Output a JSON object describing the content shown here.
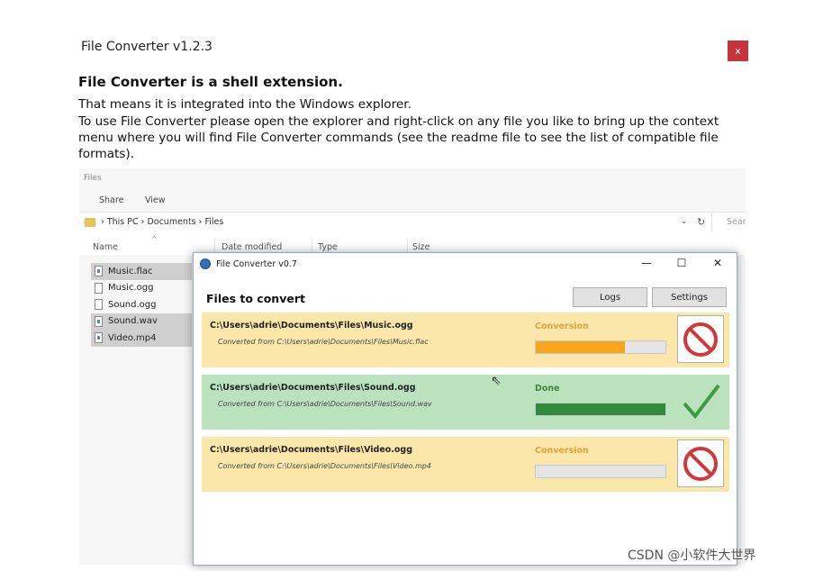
{
  "window": {
    "title": "File Converter v1.2.3",
    "close_label": "x",
    "heading": "File Converter is a shell extension.",
    "paragraph1": "That means it is integrated into the Windows explorer.",
    "paragraph2": "To use File Converter please open the explorer and right-click on any file you like to bring up the context menu where you will find File Converter commands (see the readme file to see the list of compatible file formats)."
  },
  "explorer": {
    "title": "Files",
    "ribbon_tabs": [
      "Share",
      "View"
    ],
    "breadcrumb": "›  This PC  ›  Documents  ›  Files",
    "search_placeholder": "Sear",
    "columns": [
      "Name",
      "Date modified",
      "Type",
      "Size"
    ],
    "files": [
      {
        "name": "Music.flac",
        "selected": true
      },
      {
        "name": "Music.ogg",
        "selected": false
      },
      {
        "name": "Sound.ogg",
        "selected": false
      },
      {
        "name": "Sound.wav",
        "selected": true
      },
      {
        "name": "Video.mp4",
        "selected": true
      }
    ]
  },
  "dialog": {
    "title": "File Converter v0.7",
    "heading": "Files to convert",
    "logs_label": "Logs",
    "settings_label": "Settings",
    "controls": {
      "minimize": "—",
      "maximize": "☐",
      "close": "✕"
    },
    "items": [
      {
        "path": "C:\\Users\\adrie\\Documents\\Files\\Music.ogg",
        "source": "Converted from C:\\Users\\adrie\\Documents\\Files\\Music.flac",
        "status": "Conversion",
        "progress": 0.69,
        "state": "pending"
      },
      {
        "path": "C:\\Users\\adrie\\Documents\\Files\\Sound.ogg",
        "source": "Converted from C:\\Users\\adrie\\Documents\\Files\\Sound.wav",
        "status": "Done",
        "progress": 1.0,
        "state": "done"
      },
      {
        "path": "C:\\Users\\adrie\\Documents\\Files\\Video.ogg",
        "source": "Converted from C:\\Users\\adrie\\Documents\\Files\\Video.mp4",
        "status": "Conversion",
        "progress": 0.0,
        "state": "pending"
      }
    ]
  },
  "colors": {
    "pending": "#fbe7aa",
    "done": "#b9e2bd",
    "progress_orange": "#f7a51c",
    "progress_green": "#2e8b3a",
    "status_orange": "#e4a23a",
    "status_green": "#3d8a3d",
    "cancel_red": "#d1373b"
  },
  "watermark": "CSDN @小软件大世界"
}
